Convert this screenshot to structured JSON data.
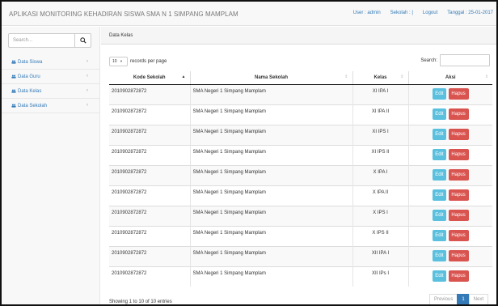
{
  "app": {
    "title": "APLIKASI MONITORING KEHADIRAN SISWA SMA N 1 SIMPANG MAMPLAM"
  },
  "topnav": {
    "user": "User : admin",
    "sekolah": "Sekolah : |",
    "logout": "Logout",
    "tanggal": "Tanggal : 25-01-2017"
  },
  "sidebar": {
    "search_placeholder": "Search...",
    "items": [
      {
        "label": "Data Siswa"
      },
      {
        "label": "Data Guru"
      },
      {
        "label": "Data Kelas"
      },
      {
        "label": "Data Sekolah"
      }
    ]
  },
  "panel": {
    "title": "Data Kelas"
  },
  "table_controls": {
    "length_value": "10",
    "length_label": "records per page",
    "search_label": "Search:"
  },
  "table": {
    "columns": [
      "Kode Sekolah",
      "Nama Sekolah",
      "Kelas",
      "Aksi"
    ],
    "rows": [
      {
        "kode": "2010902872872",
        "nama": "SMA Negeri 1 Simpang Mamplam",
        "kelas": "XI IPA I"
      },
      {
        "kode": "2010902872872",
        "nama": "SMA Negeri 1 Simpang Mamplam",
        "kelas": "XI IPA II"
      },
      {
        "kode": "2010902872872",
        "nama": "SMA Negeri 1 Simpang Mamplam",
        "kelas": "XI IPS I"
      },
      {
        "kode": "2010902872872",
        "nama": "SMA Negeri 1 Simpang Mamplam",
        "kelas": "XI IPS II"
      },
      {
        "kode": "2010902872872",
        "nama": "SMA Negeri 1 Simpang Mamplam",
        "kelas": "X IPA I"
      },
      {
        "kode": "2010902872872",
        "nama": "SMA Negeri 1 Simpang Mamplam",
        "kelas": "X IPA II"
      },
      {
        "kode": "2010902872872",
        "nama": "SMA Negeri 1 Simpang Mamplam",
        "kelas": "X IPS I"
      },
      {
        "kode": "2010902872872",
        "nama": "SMA Negeri 1 Simpang Mamplam",
        "kelas": "X IPS II"
      },
      {
        "kode": "2010902872872",
        "nama": "SMA Negeri 1 Simpang Mamplam",
        "kelas": "XII IPA I"
      },
      {
        "kode": "2010902872872",
        "nama": "SMA Negeri 1 Simpang Mamplam",
        "kelas": "XII IPs I"
      }
    ],
    "edit_label": "Edit",
    "hapus_label": "Hapus"
  },
  "footer": {
    "info": "Showing 1 to 10 of 10 entries",
    "pager": {
      "previous": "Previous",
      "page": "1",
      "next": "Next"
    }
  },
  "colors": {
    "accent": "#337ab7",
    "edit": "#5bc0de",
    "hapus": "#d9534f"
  }
}
